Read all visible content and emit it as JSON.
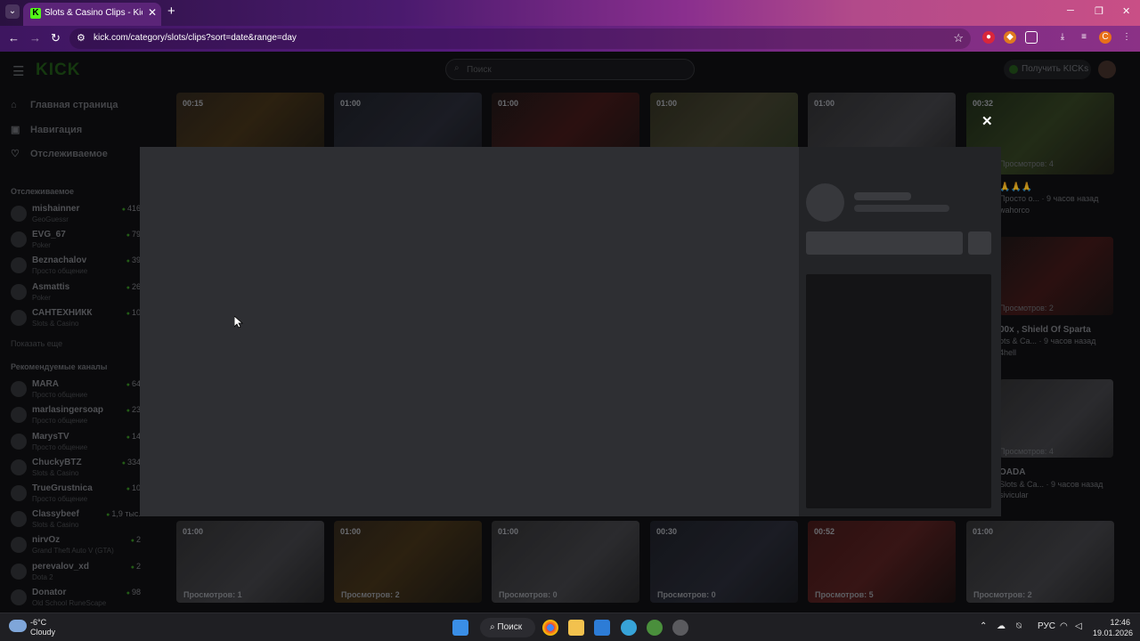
{
  "browser": {
    "tab_title": "Slots & Casino Clips - Kick Stre",
    "url": "kick.com/category/slots/clips?sort=date&range=day",
    "favicon_letter": "K",
    "profile_letter": "C"
  },
  "header": {
    "logo": "KICK",
    "search_placeholder": "Поиск",
    "get_kicks_label": "Получить KICKs"
  },
  "sidebar": {
    "main_nav": [
      {
        "label": "Главная страница",
        "icon": "home-icon"
      },
      {
        "label": "Навигация",
        "icon": "compass-icon"
      },
      {
        "label": "Отслеживаемое",
        "icon": "heart-icon"
      }
    ],
    "following_heading": "Отслеживаемое",
    "following": [
      {
        "name": "mishainner",
        "category": "GeoGuessr",
        "viewers": "416"
      },
      {
        "name": "EVG_67",
        "category": "Poker",
        "viewers": "79"
      },
      {
        "name": "Beznachalov",
        "category": "Просто общение",
        "viewers": "39"
      },
      {
        "name": "Asmattis",
        "category": "Poker",
        "viewers": "26"
      },
      {
        "name": "САНТЕХНИКК",
        "category": "Slots & Casino",
        "viewers": "10"
      }
    ],
    "show_more": "Показать еще",
    "recommended_heading": "Рекомендуемые каналы",
    "recommended": [
      {
        "name": "MARA",
        "category": "Просто общение",
        "viewers": "64"
      },
      {
        "name": "marlasingersoap",
        "category": "Просто общение",
        "viewers": "23"
      },
      {
        "name": "MarysTV",
        "category": "Просто общение",
        "viewers": "14"
      },
      {
        "name": "ChuckyBTZ",
        "category": "Slots & Casino",
        "viewers": "334"
      },
      {
        "name": "TrueGrustnica",
        "category": "Просто общение",
        "viewers": "10"
      },
      {
        "name": "Classybeef",
        "category": "Slots & Casino",
        "viewers": "1,9 тыс."
      },
      {
        "name": "nirvOz",
        "category": "Grand Theft Auto V (GTA)",
        "viewers": "2"
      },
      {
        "name": "perevalov_xd",
        "category": "Dota 2",
        "viewers": "2"
      },
      {
        "name": "Donator",
        "category": "Old School RuneScape",
        "viewers": "98"
      }
    ]
  },
  "clips_top": [
    {
      "duration": "00:15"
    },
    {
      "duration": "01:00"
    },
    {
      "duration": "01:00"
    },
    {
      "duration": "01:00"
    },
    {
      "duration": "01:00"
    },
    {
      "duration": "00:32"
    }
  ],
  "clips_bottom": [
    {
      "duration": "01:00",
      "views": "Просмотров: 1"
    },
    {
      "duration": "01:00",
      "views": "Просмотров: 2"
    },
    {
      "duration": "01:00",
      "views": "Просмотров: 0"
    },
    {
      "duration": "00:30",
      "views": "Просмотров: 0"
    },
    {
      "duration": "00:52",
      "views": "Просмотров: 5"
    },
    {
      "duration": "01:00",
      "views": "Просмотров: 2"
    }
  ],
  "right_column": [
    {
      "views": "Просмотров: 4",
      "title": "🙏🙏🙏",
      "meta": "Просто о... · 9 часов назад",
      "channel": "wahorco"
    },
    {
      "views": "Просмотров: 2",
      "title": "00x , Shield Of Sparta",
      "meta": "ots & Ca... · 9 часов назад",
      "channel": "4hell"
    },
    {
      "views": "Просмотров: 4",
      "title": "OADA",
      "meta": "Slots & Ca... · 9 часов назад",
      "channel": "sivicular"
    }
  ],
  "taskbar": {
    "temperature": "-6°C",
    "weather": "Cloudy",
    "search_label": "Поиск",
    "language": "РУС",
    "time": "12:46",
    "date": "19.01.2026"
  }
}
